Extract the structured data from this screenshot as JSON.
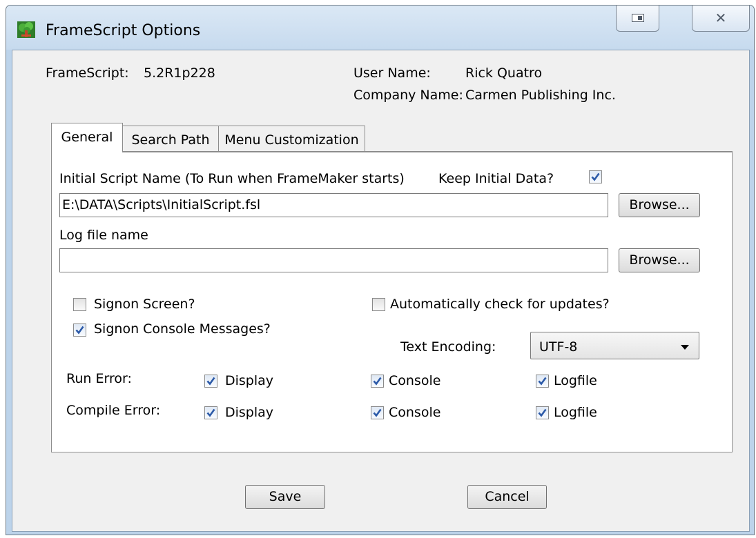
{
  "window": {
    "title": "FrameScript Options"
  },
  "header": {
    "version_label": "FrameScript:",
    "version_value": "5.2R1p228",
    "user_label": "User Name:",
    "user_value": "Rick Quatro",
    "company_label": "Company Name:",
    "company_value": "Carmen Publishing Inc."
  },
  "tabs": [
    {
      "label": "General",
      "active": true
    },
    {
      "label": "Search Path",
      "active": false
    },
    {
      "label": "Menu Customization",
      "active": false
    }
  ],
  "general": {
    "initial_script_label": "Initial Script Name (To Run when FrameMaker starts)",
    "keep_initial_label": "Keep Initial Data?",
    "keep_initial_checked": true,
    "initial_script_value": "E:\\DATA\\Scripts\\InitialScript.fsl",
    "browse_label": "Browse...",
    "log_file_label": "Log file name",
    "log_file_value": "",
    "signon_screen_label": "Signon Screen?",
    "signon_screen_checked": false,
    "signon_console_label": "Signon Console Messages?",
    "signon_console_checked": true,
    "auto_update_label": "Automatically check for updates?",
    "auto_update_checked": false,
    "text_encoding_label": "Text Encoding:",
    "text_encoding_value": "UTF-8",
    "run_error_label": "Run Error:",
    "compile_error_label": "Compile Error:",
    "display_label": "Display",
    "console_label": "Console",
    "logfile_label": "Logfile"
  },
  "footer": {
    "save_label": "Save",
    "cancel_label": "Cancel"
  },
  "colors": {
    "titlebar": "#c6daee",
    "dialog_bg": "#f0f0f0",
    "check_blue": "#2c5aa8"
  }
}
